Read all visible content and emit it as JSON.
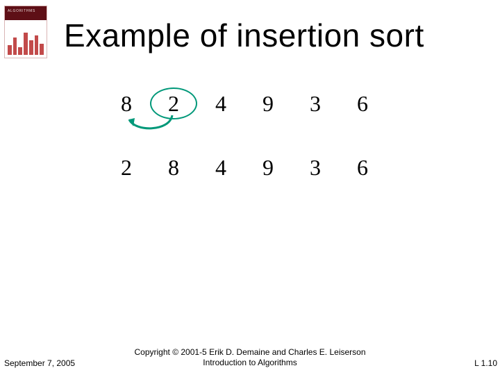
{
  "title": "Example of insertion sort",
  "rows": [
    {
      "cells": [
        "8",
        "2",
        "4",
        "9",
        "3",
        "6"
      ],
      "circleIndex": 1,
      "arrowFrom": 1,
      "arrowTo": 0
    },
    {
      "cells": [
        "2",
        "8",
        "4",
        "9",
        "3",
        "6"
      ],
      "circleIndex": null
    }
  ],
  "footer": {
    "date": "September 7, 2005",
    "copyright_line1": "Copyright © 2001-5 Erik D. Demaine and Charles E. Leiserson",
    "copyright_line2": "Introduction to Algorithms",
    "pagenum": "L 1.10"
  },
  "book_icon_label": "ALGORITHMS"
}
